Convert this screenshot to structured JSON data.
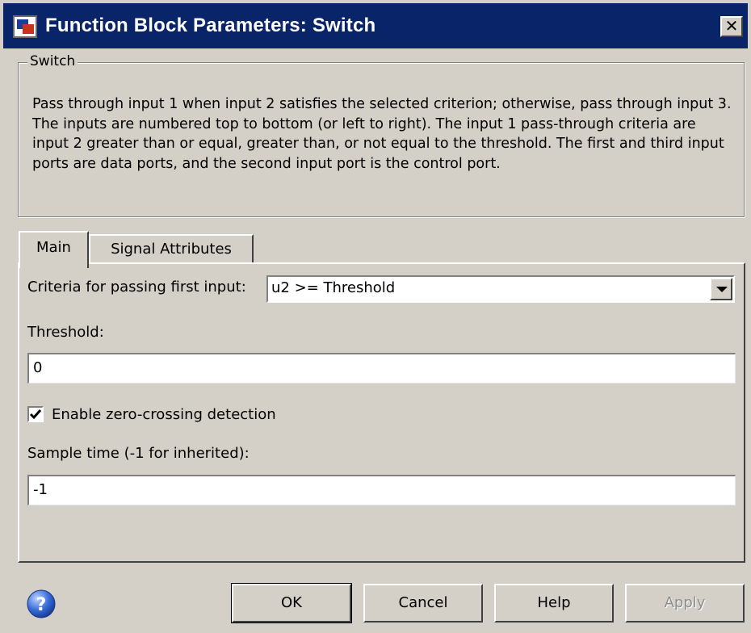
{
  "window": {
    "title": "Function Block Parameters: Switch",
    "close_glyph": "✕"
  },
  "group": {
    "legend": "Switch",
    "description": "Pass through input 1 when input 2 satisfies the selected criterion; otherwise, pass through input 3.  The inputs are numbered top to bottom (or left to right). The input 1 pass-through criteria are input 2 greater than or equal, greater than, or not equal to the threshold.  The first and third input ports are data ports, and the second input port is the control port."
  },
  "tabs": [
    {
      "label": "Main",
      "selected": true
    },
    {
      "label": "Signal Attributes",
      "selected": false
    }
  ],
  "main": {
    "criteria_label": "Criteria for passing first input:",
    "criteria_value": "u2 >= Threshold",
    "threshold_label": "Threshold:",
    "threshold_value": "0",
    "zero_crossing_label": "Enable zero-crossing detection",
    "zero_crossing_checked": true,
    "sample_time_label": "Sample time (-1 for inherited):",
    "sample_time_value": "-1"
  },
  "buttons": {
    "ok": "OK",
    "cancel": "Cancel",
    "help": "Help",
    "apply": "Apply"
  },
  "icons": {
    "app": "simulink-block-icon",
    "help": "help-question-icon",
    "close": "close-icon",
    "dropdown": "chevron-down-icon",
    "check": "checkmark-icon"
  },
  "colors": {
    "titlebar": "#0a246a",
    "face": "#d4d0c8",
    "disabled_text": "#8d8d8d"
  }
}
